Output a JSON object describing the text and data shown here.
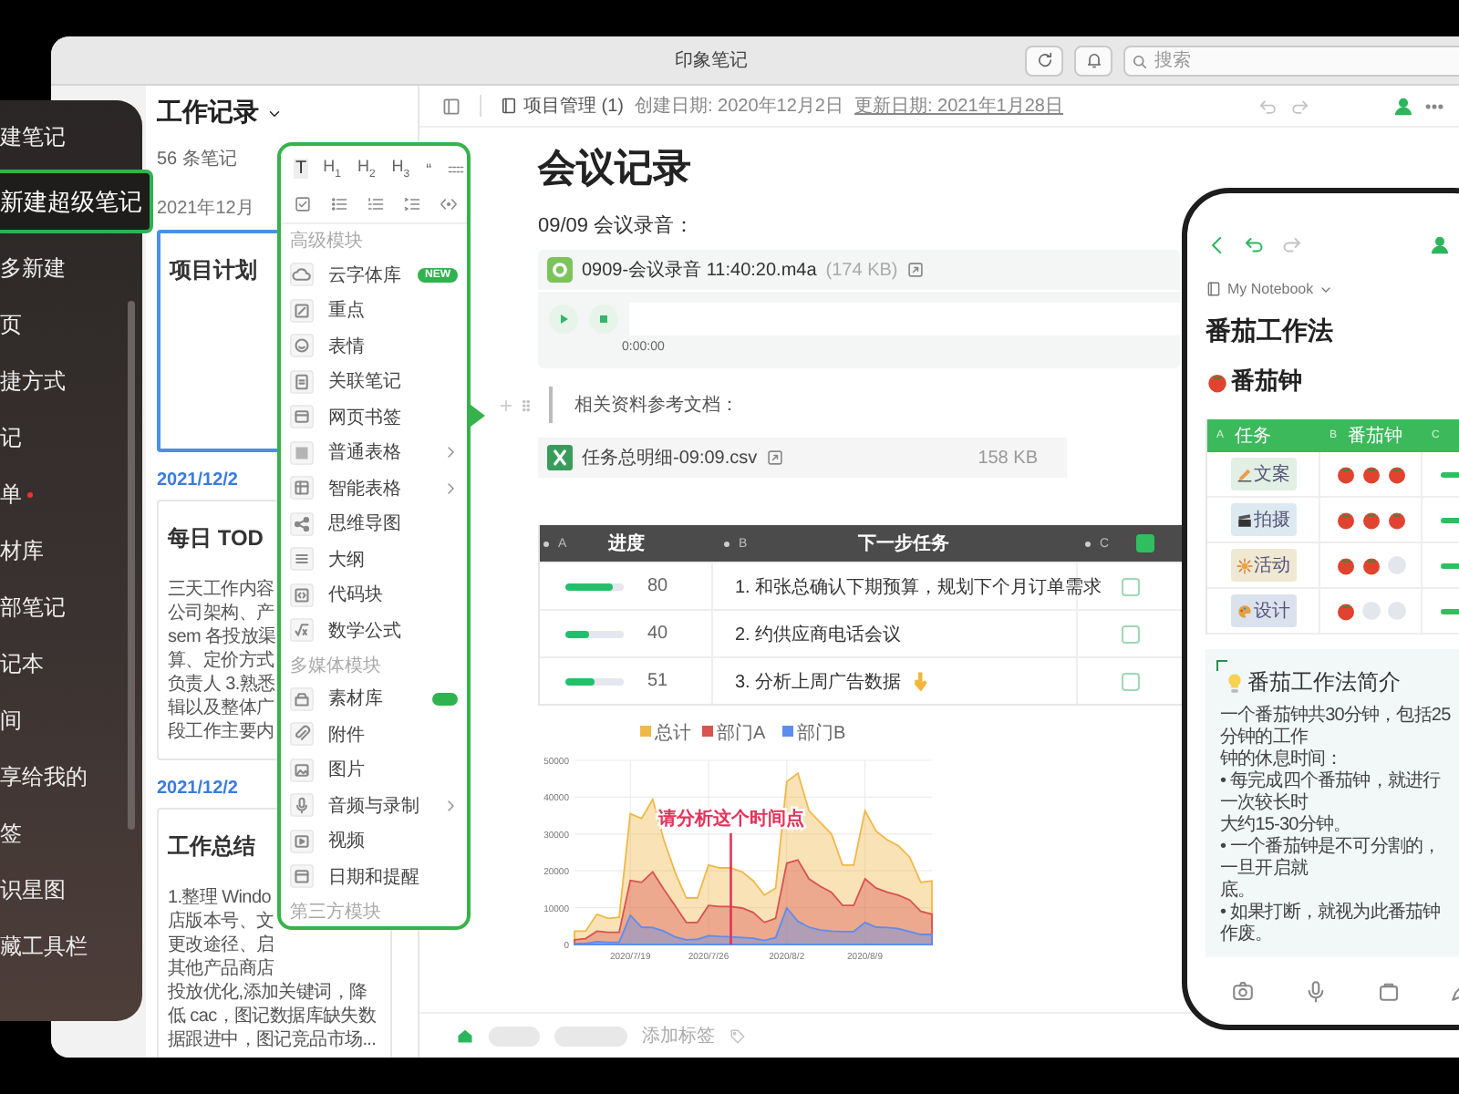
{
  "window": {
    "title": "印象笔记",
    "search": {
      "placeholder": "搜索"
    }
  },
  "sidebar": {
    "items": [
      {
        "label": "建笔记",
        "selected": false,
        "dot": false
      },
      {
        "label": "新建超级笔记",
        "selected": true,
        "dot": false
      },
      {
        "label": "多新建",
        "selected": false,
        "dot": false
      },
      {
        "label": "页",
        "selected": false,
        "dot": false
      },
      {
        "label": "捷方式",
        "selected": false,
        "dot": false
      },
      {
        "label": "记",
        "selected": false,
        "dot": false
      },
      {
        "label": "单",
        "selected": false,
        "dot": true
      },
      {
        "label": "材库",
        "selected": false,
        "dot": false
      },
      {
        "label": "部笔记",
        "selected": false,
        "dot": false
      },
      {
        "label": "记本",
        "selected": false,
        "dot": false
      },
      {
        "label": "间",
        "selected": false,
        "dot": false
      },
      {
        "label": "享给我的",
        "selected": false,
        "dot": false
      },
      {
        "label": "签",
        "selected": false,
        "dot": false
      },
      {
        "label": "识星图",
        "selected": false,
        "dot": false
      },
      {
        "label": "藏工具栏",
        "selected": false,
        "dot": false
      }
    ]
  },
  "note_list": {
    "title": "工作记录",
    "count": "56 条笔记",
    "groups": [
      {
        "kind": "month",
        "date": "2021年12月",
        "notes": [
          {
            "title": "项目计划",
            "selected": true
          }
        ]
      },
      {
        "kind": "day",
        "date": "2021/12/2",
        "notes": [
          {
            "title": "每日 TOD",
            "selected": false,
            "lines": [
              "三天工作内容",
              "公司架构、产",
              "sem 各投放渠",
              "算、定价方式",
              "负责人 3.熟悉",
              "辑以及整体广",
              "段工作主要内"
            ]
          }
        ]
      },
      {
        "kind": "day",
        "date": "2021/12/2",
        "notes": [
          {
            "title": "工作总结",
            "selected": false,
            "lines": [
              "1.整理 Windo",
              "店版本号、文",
              "更改途径、启",
              "其他产品商店",
              "投放优化,添加关键词，降",
              "低 cac，图记数据库缺失数",
              "据跟进中，图记竞品市场..."
            ]
          }
        ]
      }
    ]
  },
  "block_menu": {
    "tools": [
      "T",
      "H$_{1}$",
      "H$_{2}$",
      "H$_{3}$",
      "“"
    ],
    "sections": [
      {
        "title": "高级模块",
        "items": [
          {
            "label": "云字体库",
            "badge": "NEW",
            "submenu": false
          },
          {
            "label": "重点",
            "submenu": false
          },
          {
            "label": "表情",
            "submenu": false
          },
          {
            "label": "关联笔记",
            "submenu": false
          },
          {
            "label": "网页书签",
            "submenu": false
          },
          {
            "label": "普通表格",
            "submenu": true
          },
          {
            "label": "智能表格",
            "submenu": true
          },
          {
            "label": "思维导图",
            "submenu": false
          },
          {
            "label": "大纲",
            "submenu": false
          },
          {
            "label": "代码块",
            "submenu": false
          },
          {
            "label": "数学公式",
            "submenu": false
          }
        ]
      },
      {
        "title": "多媒体模块",
        "items": [
          {
            "label": "素材库",
            "pill": true,
            "submenu": false
          },
          {
            "label": "附件",
            "submenu": false
          },
          {
            "label": "图片",
            "submenu": false
          },
          {
            "label": "音频与录制",
            "submenu": true
          },
          {
            "label": "视频",
            "submenu": false
          },
          {
            "label": "日期和提醒",
            "submenu": false
          }
        ]
      },
      {
        "title": "第三方模块"
      }
    ]
  },
  "note": {
    "notebook": "项目管理 (1)",
    "created": "创建日期: 2020年12月2日",
    "updated": "更新日期: 2021年1月28日",
    "title": "会议记录",
    "blocks": [
      {
        "kind": "text",
        "text": "09/09 会议录音："
      },
      {
        "kind": "audio",
        "name": "0909-会议录音 11:40:20.m4a",
        "size": "(174 KB)",
        "time": "0:00:00"
      },
      {
        "kind": "quote",
        "text": "相关资料参考文档："
      },
      {
        "kind": "file",
        "name": "任务总明细-09:09.csv",
        "size": "158 KB"
      },
      {
        "kind": "table",
        "columns": [
          {
            "letter": "A",
            "title": "进度"
          },
          {
            "letter": "B",
            "title": "下一步任务"
          },
          {
            "letter": "C",
            "checked": true
          }
        ],
        "rows": [
          {
            "level": 0.8,
            "value": "80",
            "task": "1. 和张总确认下期预算，规划下个月订单需求",
            "pointer": false,
            "checked": false
          },
          {
            "level": 0.4,
            "value": "40",
            "task": "2. 约供应商电话会议",
            "pointer": false,
            "checked": false
          },
          {
            "level": 0.51,
            "value": "51",
            "task": "3. 分析上周广告数据",
            "pointer": true,
            "checked": false
          }
        ]
      },
      {
        "kind": "chart",
        "chart_data": {
          "type": "area",
          "stacked": false,
          "grid": true,
          "legend": true,
          "categories": [
            null,
            null,
            null,
            null,
            null,
            "2020/7/19",
            null,
            null,
            null,
            null,
            null,
            null,
            "2020/7/26",
            null,
            null,
            null,
            null,
            null,
            null,
            "2020/8/2",
            null,
            null,
            null,
            null,
            null,
            null,
            "2020/8/9",
            null,
            null,
            null,
            null,
            null,
            null
          ],
          "series": [
            {
              "name": "总计",
              "color": "#f0b849",
              "values": [
                3600,
                3600,
                8200,
                7100,
                7400,
                35500,
                34200,
                39400,
                28400,
                19700,
                12600,
                12600,
                21600,
                20800,
                20800,
                19700,
                17300,
                13400,
                15300,
                44200,
                46500,
                36300,
                33100,
                30000,
                21600,
                21600,
                36300,
                30800,
                28400,
                26800,
                23700,
                16900,
                17300
              ]
            },
            {
              "name": "部门A",
              "color": "#d9534f",
              "values": [
                1300,
                1600,
                3600,
                3300,
                3300,
                17400,
                16900,
                19700,
                15000,
                10600,
                6000,
                6000,
                10600,
                10300,
                10300,
                9900,
                8700,
                6000,
                7100,
                22100,
                22900,
                17800,
                15800,
                14200,
                10600,
                10600,
                17800,
                15300,
                14200,
                13400,
                12100,
                9000,
                8200
              ]
            },
            {
              "name": "部门B",
              "color": "#5b8def",
              "values": [
                300,
                300,
                800,
                600,
                600,
                7900,
                4700,
                4600,
                3600,
                2100,
                1300,
                1400,
                2400,
                2200,
                2100,
                1900,
                1700,
                1100,
                1900,
                9900,
                6300,
                4700,
                3900,
                3600,
                3500,
                3500,
                6000,
                4700,
                4600,
                4300,
                3500,
                2700,
                2700
              ]
            }
          ],
          "ylim": [
            0,
            50000
          ],
          "yticks": [
            0,
            10000,
            20000,
            30000,
            40000,
            50000
          ],
          "annotations": [
            {
              "text": "请分析这个时间点"
            }
          ]
        }
      }
    ],
    "tags": {
      "hint": "添加标签"
    }
  },
  "phone": {
    "notebook": "My Notebook",
    "title": "番茄工作法",
    "heading": "番茄钟",
    "table": {
      "columns": [
        {
          "letter": "A",
          "title": "任务"
        },
        {
          "letter": "B",
          "title": "番茄钟"
        },
        {
          "letter": "C"
        }
      ],
      "rows": [
        {
          "task": "文案",
          "color": "#e2efe4",
          "stars": 3
        },
        {
          "task": "拍摄",
          "color": "#dde9f0",
          "stars": 3
        },
        {
          "task": "活动",
          "color": "#efe8d3",
          "stars": 2
        },
        {
          "task": "设计",
          "color": "#dbe2ee",
          "stars": 1
        }
      ]
    },
    "intro": {
      "title": "番茄工作法简介",
      "lines": [
        "一个番茄钟共30分钟，包括25分钟的工作",
        "钟的休息时间：",
        "• 每完成四个番茄钟，就进行一次较长时",
        "大约15-30分钟。",
        "• 一个番茄钟是不可分割的，一旦开启就",
        "底。",
        "• 如果打断，就视为此番茄钟作废。"
      ]
    }
  }
}
